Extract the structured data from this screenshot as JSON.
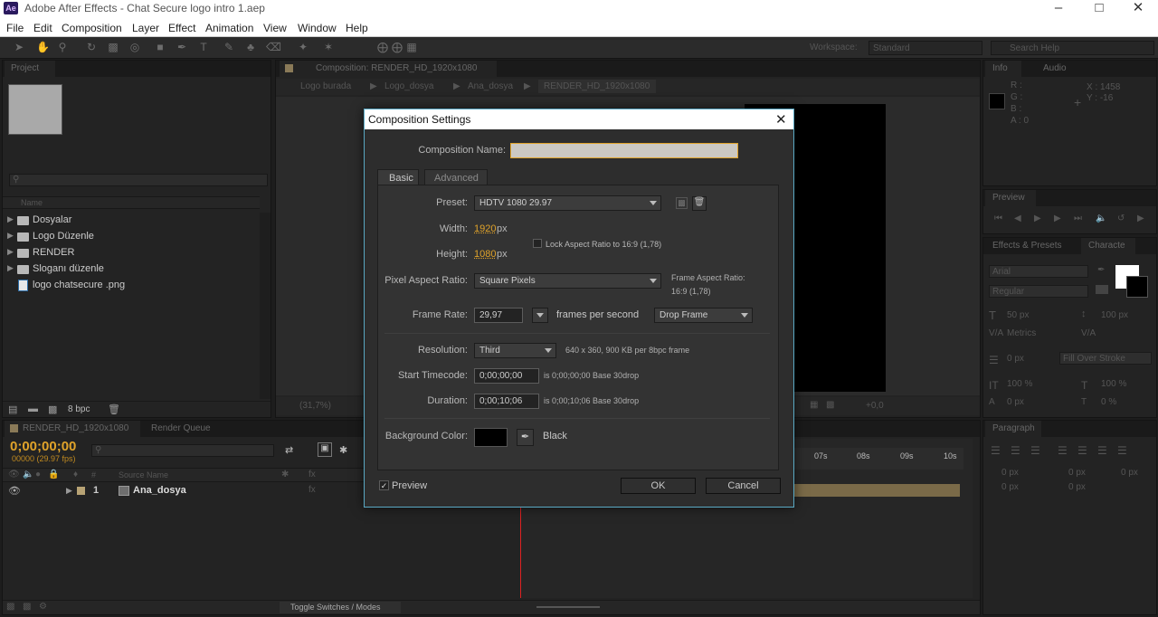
{
  "window": {
    "title": "Adobe After Effects - Chat Secure logo intro 1.aep",
    "logo": "Ae"
  },
  "menu": [
    "File",
    "Edit",
    "Composition",
    "Layer",
    "Effect",
    "Animation",
    "View",
    "Window",
    "Help"
  ],
  "workspace": {
    "label": "Workspace:",
    "value": "Standard"
  },
  "search_help": {
    "placeholder": "Search Help"
  },
  "project": {
    "tab": "Project",
    "column_name": "Name",
    "items": [
      {
        "name": "Dosyalar",
        "type": "folder"
      },
      {
        "name": "Logo Düzenle",
        "type": "folder"
      },
      {
        "name": "RENDER",
        "type": "folder"
      },
      {
        "name": "Sloganı düzenle",
        "type": "folder"
      },
      {
        "name": "logo chatsecure .png",
        "type": "file"
      }
    ],
    "bpc": "8 bpc"
  },
  "composition": {
    "tab": "Composition: RENDER_HD_1920x1080",
    "breadcrumbs": [
      "Logo burada",
      "Logo_dosya",
      "Ana_dosya",
      "RENDER_HD_1920x1080"
    ],
    "zoom": "(31,7%)",
    "offset": "+0,0"
  },
  "info": {
    "tab": "Info",
    "tab2": "Audio",
    "r": "R :",
    "g": "G :",
    "b": "B :",
    "a": "A : 0",
    "x": "X : 1458",
    "y": "Y : -16"
  },
  "preview": {
    "tab": "Preview"
  },
  "effects": {
    "tab": "Effects & Presets",
    "tab2": "Characte",
    "font": "Arial",
    "style": "Regular",
    "size": "50 px",
    "leading": "100 px",
    "kerning": "Metrics",
    "tracking": "0 px",
    "stroke": "Fill Over Stroke",
    "vscale": "100 %",
    "hscale": "100 %",
    "baseline": "0 px",
    "tsume": "0 %"
  },
  "paragraph": {
    "tab": "Paragraph",
    "v1": "0 px",
    "v2": "0 px",
    "v3": "0 px",
    "v4": "0 px",
    "v5": "0 px"
  },
  "timeline": {
    "tab": "RENDER_HD_1920x1080",
    "tab2": "Render Queue",
    "timecode": "0;00;00;00",
    "frames": "00000 (29.97 fps)",
    "col_num": "#",
    "col_source": "Source Name",
    "layer_num": "1",
    "layer_name": "Ana_dosya",
    "ruler": [
      "07s",
      "08s",
      "09s",
      "10s"
    ],
    "toggle": "Toggle Switches / Modes"
  },
  "dialog": {
    "title": "Composition Settings",
    "name_label": "Composition Name:",
    "name_value": "",
    "tabs": [
      "Basic",
      "Advanced"
    ],
    "preset_label": "Preset:",
    "preset": "HDTV 1080 29.97",
    "width_label": "Width:",
    "width": "1920",
    "px1": "px",
    "height_label": "Height:",
    "height": "1080",
    "px2": "px",
    "lock": "Lock Aspect Ratio to 16:9 (1,78)",
    "par_label": "Pixel Aspect Ratio:",
    "par": "Square Pixels",
    "far_label": "Frame Aspect Ratio:",
    "far": "16:9 (1,78)",
    "fr_label": "Frame Rate:",
    "fr": "29,97",
    "fps": "frames per second",
    "drop": "Drop Frame",
    "res_label": "Resolution:",
    "res": "Third",
    "res_info": "640 x 360, 900 KB per 8bpc frame",
    "st_label": "Start Timecode:",
    "st": "0;00;00;00",
    "st_info": "is 0;00;00;00  Base 30drop",
    "dur_label": "Duration:",
    "dur": "0;00;10;06",
    "dur_info": "is 0;00;10;06  Base 30drop",
    "bg_label": "Background Color:",
    "bg_name": "Black",
    "bg_color": "#000000",
    "preview": "Preview",
    "ok": "OK",
    "cancel": "Cancel"
  }
}
